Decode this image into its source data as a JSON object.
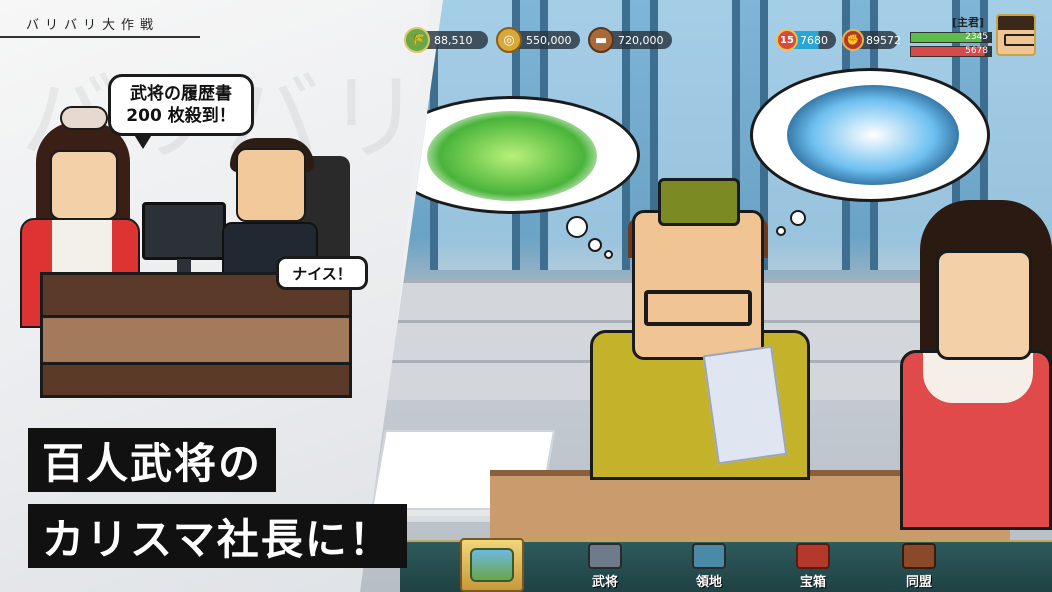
{
  "brand": "バリバリ大作戦",
  "watermark": "バリバリ",
  "illustration": {
    "speech_line1": "武将の履歴書",
    "speech_line2": "200 枚殺到！",
    "reply": "ナイス！"
  },
  "headline": {
    "line1": "百人武将の",
    "line2": "カリスマ社長に！"
  },
  "hud": {
    "resources": [
      {
        "icon": "food-icon",
        "value": "88,510"
      },
      {
        "icon": "gold-coin-icon",
        "value": "550,000"
      },
      {
        "icon": "wood-log-icon",
        "value": "720,000"
      }
    ],
    "stamina": {
      "level": "15",
      "value": "7680"
    },
    "power": {
      "value": "89572"
    },
    "lord": {
      "tag": "[主君]",
      "hp": "2345",
      "hp_fill": 0.88,
      "mp": "5678",
      "mp_fill": 0.92
    }
  },
  "nav": {
    "active_icon": "castle-home-icon",
    "items": [
      {
        "label": "武将",
        "icon": "general-icon"
      },
      {
        "label": "領地",
        "icon": "territory-icon"
      },
      {
        "label": "宝箱",
        "icon": "treasure-chest-icon"
      },
      {
        "label": "同盟",
        "icon": "alliance-icon"
      }
    ]
  },
  "colors": {
    "hud_bg": "#283440",
    "nav_bg": "#2e5a5c",
    "nav_accent": "#c2a559",
    "headline_bg": "#111111"
  }
}
